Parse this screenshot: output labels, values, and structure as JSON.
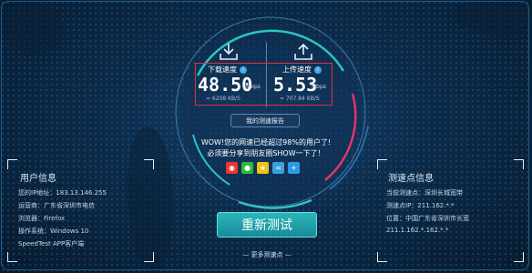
{
  "download": {
    "label": "下载速度",
    "value": "48.50",
    "unit": "Mbps",
    "sub": "≈ 6208 KB/S"
  },
  "upload": {
    "label": "上传速度",
    "value": "5.53",
    "unit": "Mbps",
    "sub": "≈ 707.84 KB/S"
  },
  "report_button": "我的测速报告",
  "message_line1": "WOW!您的网速已经超过98%的用户了!",
  "message_line2": "必须要分享到朋友圈SHOW一下了！",
  "share_icons": [
    {
      "name": "weibo-icon",
      "glyph": "◉",
      "color": "#e8372f"
    },
    {
      "name": "wechat-icon",
      "glyph": "●",
      "color": "#2fb93a"
    },
    {
      "name": "star-icon",
      "glyph": "★",
      "color": "#f3c11c"
    },
    {
      "name": "link-icon",
      "glyph": "∞",
      "color": "#3aa1e0"
    },
    {
      "name": "plus-icon",
      "glyph": "+",
      "color": "#2b9be8"
    }
  ],
  "retest_button": "重新测试",
  "more_points": "更多测速点",
  "user_info": {
    "title": "用户信息",
    "lines": [
      "您的IP地址：183.13.146.255",
      "运营商：广东省深圳市电信",
      "浏览器：Firefox",
      "操作系统：Windows 10",
      "SpeedTest APP客户端"
    ]
  },
  "test_point": {
    "title": "测速点信息",
    "lines": [
      "当前测速点：深圳长城宽带",
      "测速点IP：211.162.*.*",
      "位置：中国广东省深圳市长宽",
      "211.1.162.*.162.*.*"
    ]
  },
  "colors": {
    "accent": "#2bb7b9",
    "highlight": "#e0303a",
    "ring": "#2ec4c4",
    "ring2": "#e2356f"
  }
}
